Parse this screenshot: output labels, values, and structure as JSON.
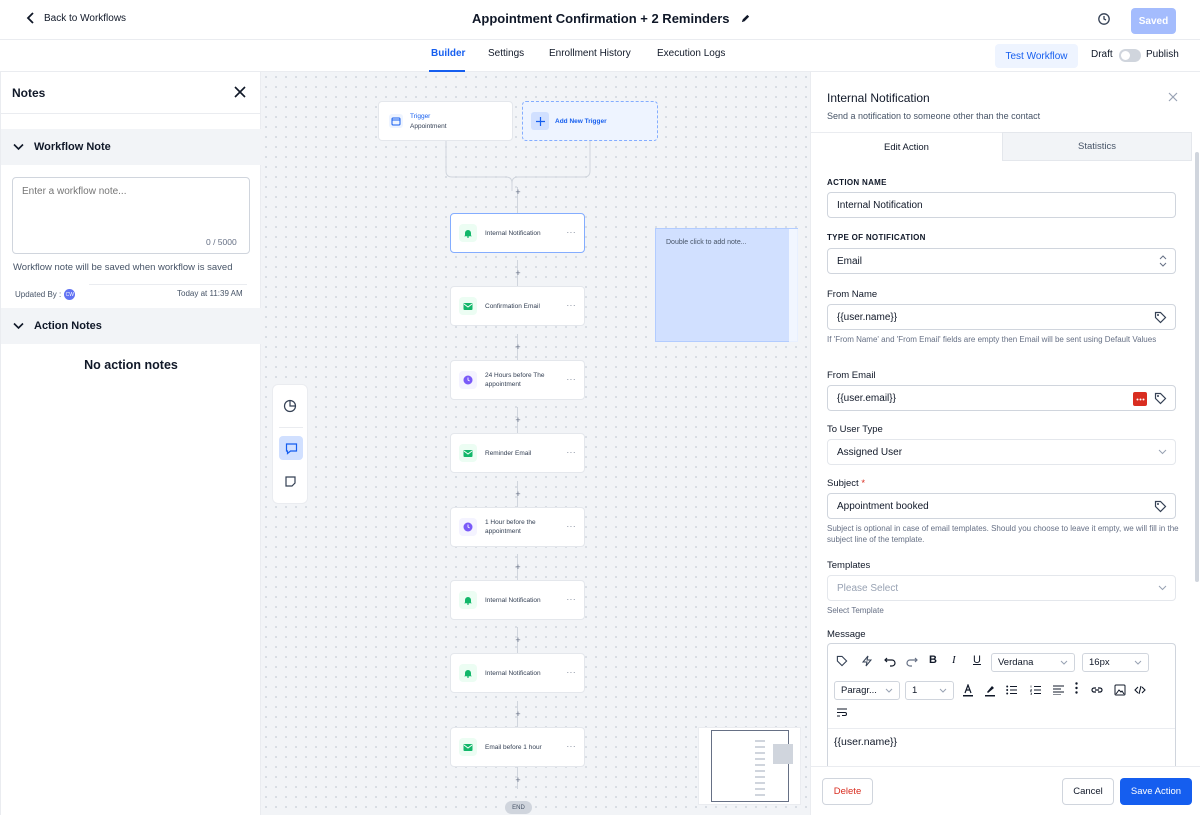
{
  "header": {
    "back_label": "Back to Workflows",
    "title": "Appointment Confirmation + 2 Reminders",
    "saved_label": "Saved"
  },
  "tabs": [
    "Builder",
    "Settings",
    "Enrollment History",
    "Execution Logs"
  ],
  "active_tab": "Builder",
  "actions": {
    "test_label": "Test Workflow",
    "draft_label": "Draft",
    "publish_label": "Publish"
  },
  "notes": {
    "title": "Notes",
    "workflow_note_heading": "Workflow Note",
    "placeholder": "Enter a workflow note...",
    "count": "0 / 5000",
    "hint": "Workflow note will be saved when workflow is saved",
    "updated_by_label": "Updated By :",
    "avatar_initials": "CW",
    "updated_at": "Today at 11:39 AM",
    "action_notes_heading": "Action Notes",
    "empty": "No action notes"
  },
  "canvas": {
    "trigger": {
      "label": "Trigger",
      "sub": "Appointment"
    },
    "add_trigger": "Add New Trigger",
    "nodes": [
      {
        "label": "Internal Notification",
        "icon": "bell-icon",
        "kind": "g"
      },
      {
        "label": "Confirmation Email",
        "icon": "mail-icon",
        "kind": "g"
      },
      {
        "label": "24 Hours before The appointment",
        "icon": "clock-icon",
        "kind": "p"
      },
      {
        "label": "Reminder Email",
        "icon": "mail-icon",
        "kind": "g"
      },
      {
        "label": "1 Hour before the appointment",
        "icon": "clock-icon",
        "kind": "p"
      },
      {
        "label": "Internal Notification",
        "icon": "bell-icon",
        "kind": "g"
      },
      {
        "label": "Internal Notification",
        "icon": "bell-icon",
        "kind": "g"
      },
      {
        "label": "Email before 1 hour",
        "icon": "mail-icon",
        "kind": "g"
      }
    ],
    "end_label": "END",
    "sticky_note": "Double click to add note..."
  },
  "panel": {
    "title": "Internal Notification",
    "subtitle": "Send a notification to someone other than the contact",
    "tab_edit": "Edit Action",
    "tab_stats": "Statistics",
    "action_name_label": "ACTION NAME",
    "action_name": "Internal Notification",
    "type_label": "TYPE OF NOTIFICATION",
    "type_value": "Email",
    "from_name_label": "From Name",
    "from_name": "{{user.name}}",
    "from_help": "If 'From Name' and 'From Email' fields are empty then Email will be sent using Default Values",
    "from_email_label": "From Email",
    "from_email": "{{user.email}}",
    "to_user_type_label": "To User Type",
    "to_user_type": "Assigned User",
    "subject_label": "Subject",
    "subject_required": "*",
    "subject": "Appointment booked",
    "subject_help": "Subject is optional in case of email templates. Should you choose to leave it empty, we will fill in the subject line of the template.",
    "templates_label": "Templates",
    "templates_placeholder": "Please Select",
    "templates_help": "Select Template",
    "message_label": "Message",
    "font": "Verdana",
    "font_size": "16px",
    "paragraph": "Paragr...",
    "line_height": "1",
    "message_body": "{{user.name}}",
    "delete_label": "Delete",
    "cancel_label": "Cancel",
    "save_label": "Save Action"
  },
  "colors": {
    "primary": "#155eef",
    "danger": "#d92d20",
    "sticky": "#d1e0ff"
  }
}
